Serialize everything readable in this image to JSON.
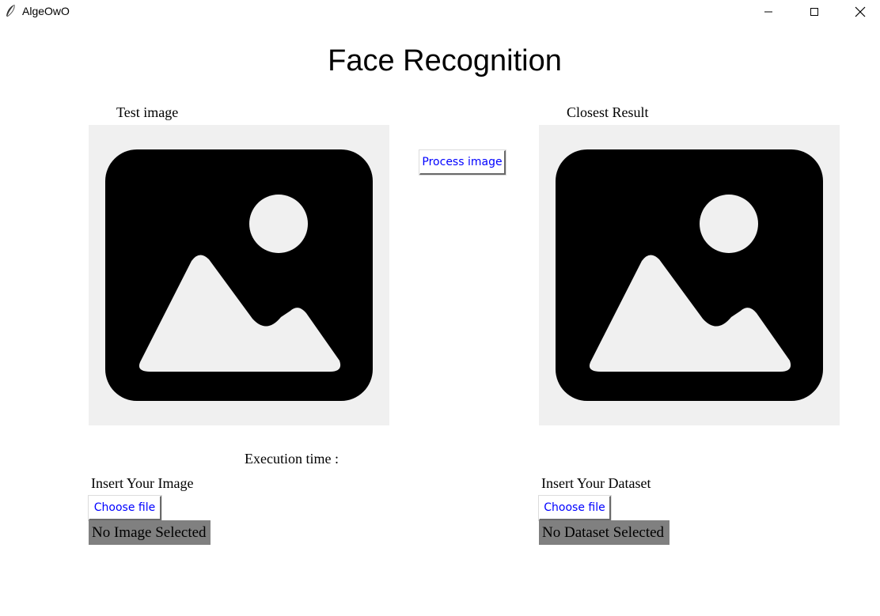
{
  "window": {
    "title": "AlgeOwO",
    "icon": "feather-icon",
    "controls": [
      "minimize-icon",
      "maximize-icon",
      "close-icon"
    ]
  },
  "heading": "Face Recognition",
  "test_panel": {
    "label": "Test image",
    "image_icon": "image-placeholder-icon"
  },
  "result_panel": {
    "label": "Closest Result",
    "image_icon": "image-placeholder-icon"
  },
  "process_button": "Process image",
  "execution_time_label": "Execution time :",
  "image_input": {
    "label": "Insert Your Image",
    "button": "Choose file",
    "status": "No Image Selected"
  },
  "dataset_input": {
    "label": "Insert Your Dataset",
    "button": "Choose file",
    "status": "No Dataset Selected"
  },
  "colors": {
    "button_text": "#0000ff",
    "panel_bg": "#f0f0f0",
    "status_bg": "#808080"
  }
}
